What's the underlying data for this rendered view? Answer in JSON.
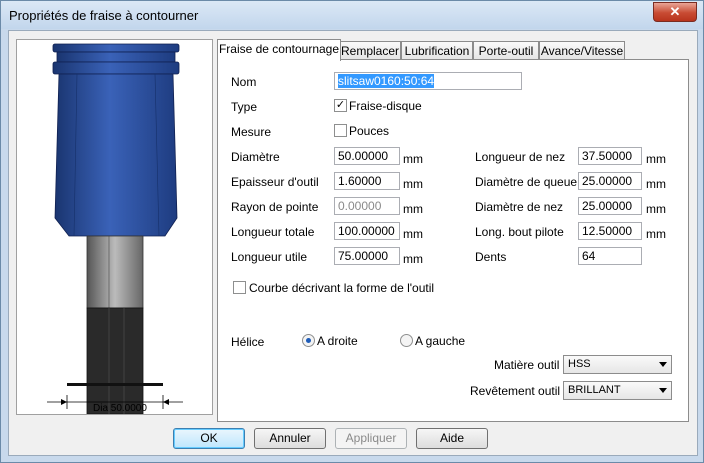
{
  "window": {
    "title": "Propriétés de fraise à contourner",
    "close_glyph": "✕"
  },
  "preview": {
    "dimension_label": "Dia 50.0000"
  },
  "tabs": [
    {
      "label": "Fraise de contournage",
      "active": true
    },
    {
      "label": "Remplacer",
      "active": false
    },
    {
      "label": "Lubrification",
      "active": false
    },
    {
      "label": "Porte-outil",
      "active": false
    },
    {
      "label": "Avance/Vitesse",
      "active": false
    }
  ],
  "form": {
    "name_label": "Nom",
    "name_value": "slitsaw0160:50:64",
    "type_label": "Type",
    "type_option": "Fraise-disque",
    "type_checked": true,
    "measure_label": "Mesure",
    "measure_option": "Pouces",
    "measure_checked": false,
    "unit": "mm",
    "left_fields": [
      {
        "label": "Diamètre",
        "value": "50.00000",
        "disabled": false
      },
      {
        "label": "Epaisseur d'outil",
        "value": "1.60000",
        "disabled": false
      },
      {
        "label": "Rayon de pointe",
        "value": "0.00000",
        "disabled": true
      },
      {
        "label": "Longueur totale",
        "value": "100.00000",
        "disabled": false
      },
      {
        "label": "Longueur utile",
        "value": "75.00000",
        "disabled": false
      }
    ],
    "right_fields": [
      {
        "label": "Longueur de nez",
        "value": "37.50000",
        "unit": "mm"
      },
      {
        "label": "Diamètre de queue",
        "value": "25.00000",
        "unit": "mm"
      },
      {
        "label": "Diamètre de nez",
        "value": "25.00000",
        "unit": "mm"
      },
      {
        "label": "Long. bout pilote",
        "value": "12.50000",
        "unit": "mm"
      },
      {
        "label": "Dents",
        "value": "64",
        "unit": ""
      }
    ],
    "curve_label": "Courbe décrivant la forme de l'outil",
    "curve_checked": false,
    "helix_label": "Hélice",
    "helix_right": "A droite",
    "helix_left": "A gauche",
    "helix_selected": "right",
    "material_label": "Matière outil",
    "material_value": "HSS",
    "coating_label": "Revêtement outil",
    "coating_value": "BRILLANT"
  },
  "buttons": {
    "ok": "OK",
    "cancel": "Annuler",
    "apply": "Appliquer",
    "help": "Aide"
  },
  "colors": {
    "tool_blue": "#2a4fa0",
    "selection": "#3399ff",
    "title_bg": "#c8d9ec"
  }
}
